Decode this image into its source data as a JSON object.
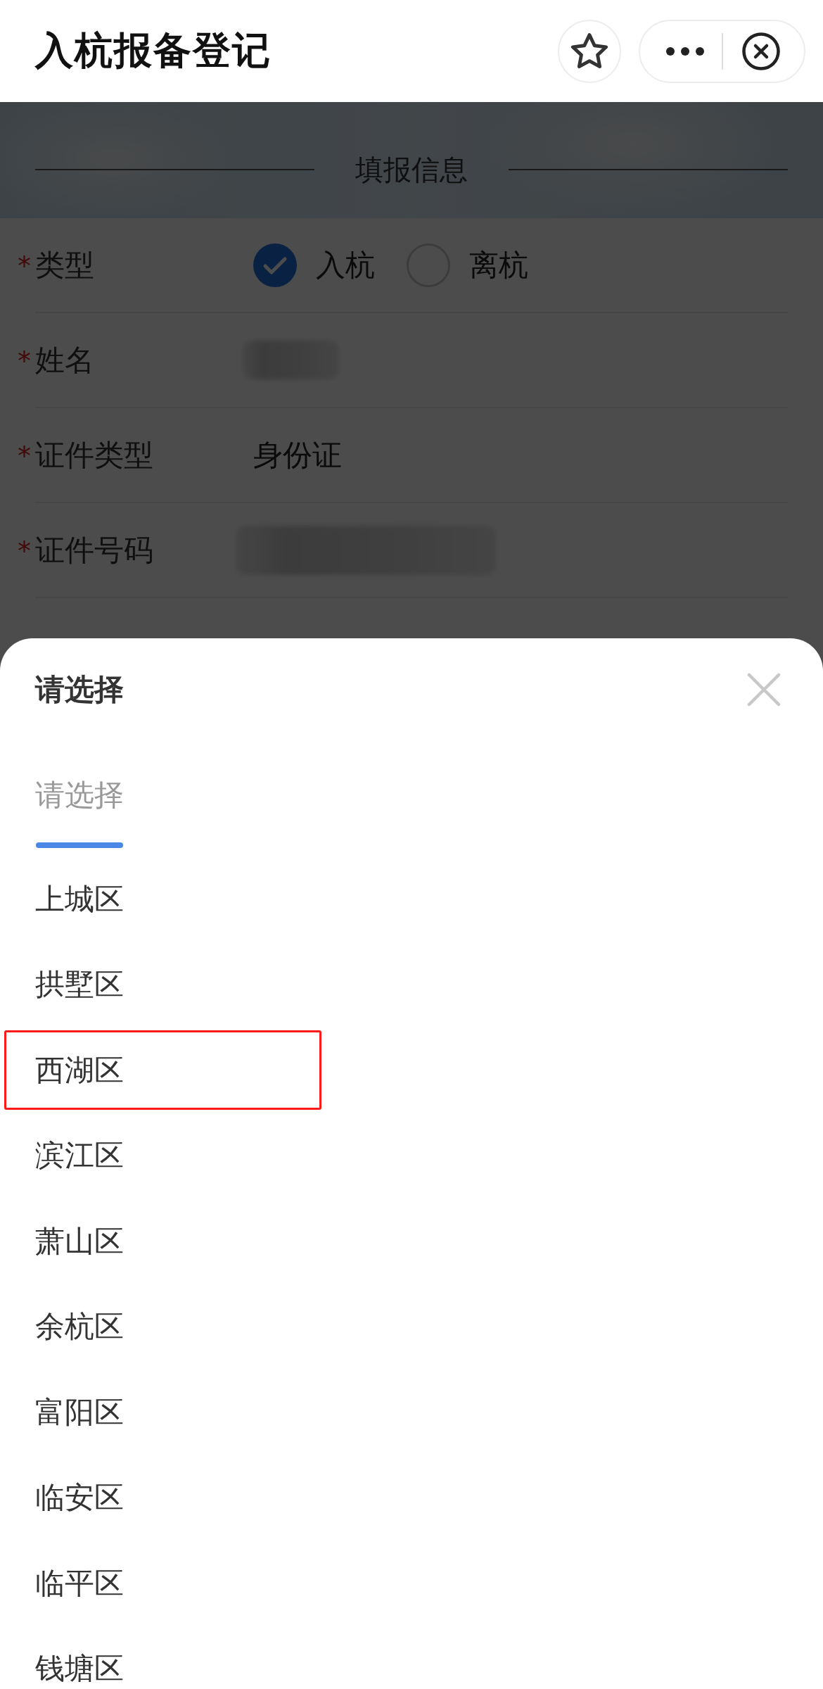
{
  "nav_bar": {
    "title": "入杭报备登记"
  },
  "section_title": "填报信息",
  "form": {
    "rows": [
      {
        "kind": "radio",
        "mark": "*",
        "label": "类型",
        "options": [
          {
            "label": "入杭",
            "selected": true
          },
          {
            "label": "离杭",
            "selected": false
          }
        ]
      },
      {
        "kind": "redacted",
        "mark": "*",
        "label": "姓名"
      },
      {
        "kind": "text",
        "mark": "*",
        "label": "证件类型",
        "value": "身份证"
      },
      {
        "kind": "redacted",
        "mark": "*",
        "label": "证件号码"
      }
    ]
  },
  "picker": {
    "title": "请选择",
    "tabs": [
      {
        "label": "请选择",
        "selected": true
      }
    ],
    "options": [
      {
        "label": "上城区",
        "highlighted": false
      },
      {
        "label": "拱墅区",
        "highlighted": false
      },
      {
        "label": "西湖区",
        "highlighted": true
      },
      {
        "label": "滨江区",
        "highlighted": false
      },
      {
        "label": "萧山区",
        "highlighted": false
      },
      {
        "label": "余杭区",
        "highlighted": false
      },
      {
        "label": "富阳区",
        "highlighted": false
      },
      {
        "label": "临安区",
        "highlighted": false
      },
      {
        "label": "临平区",
        "highlighted": false
      },
      {
        "label": "钱塘区",
        "highlighted": false
      }
    ]
  }
}
